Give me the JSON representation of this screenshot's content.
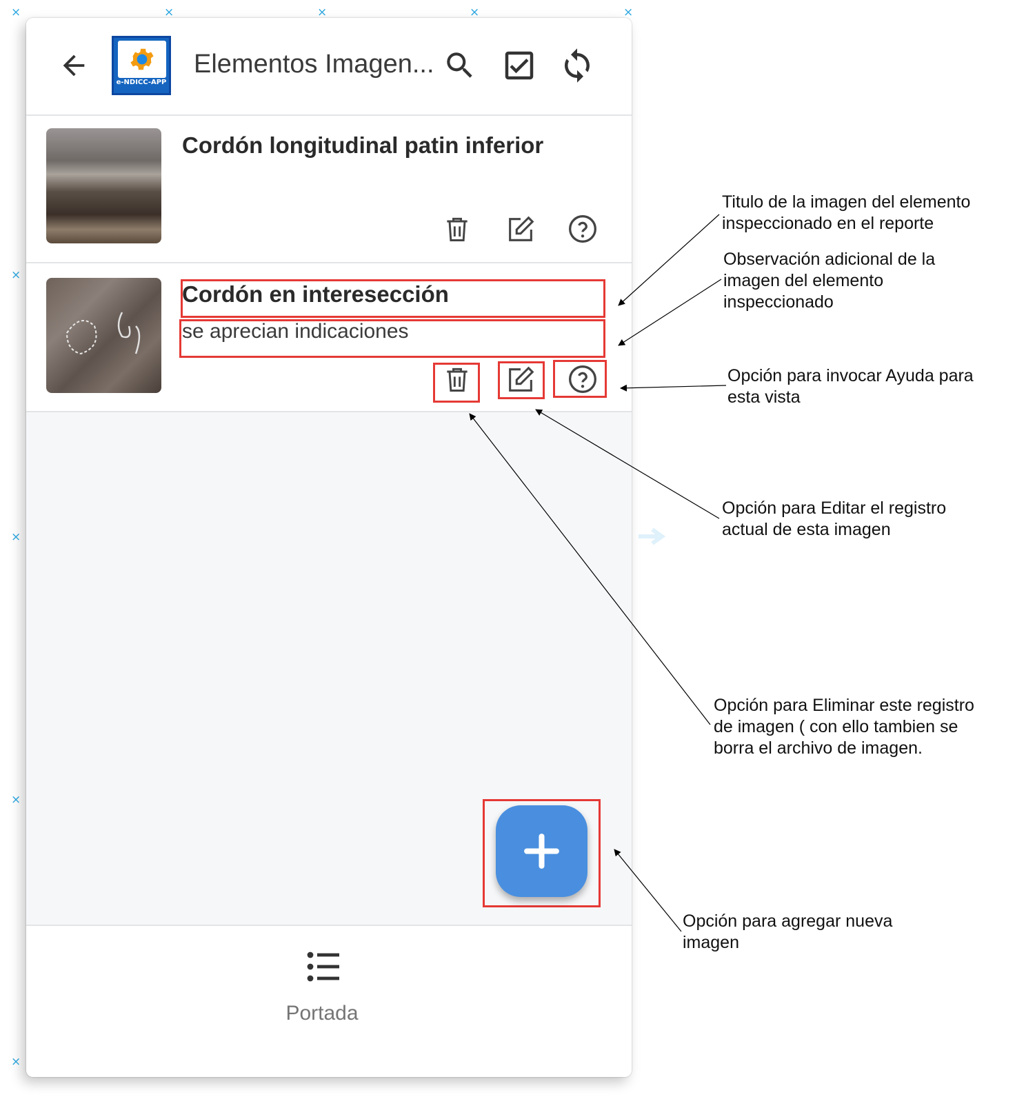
{
  "appbar": {
    "back_icon": "arrow-left-icon",
    "logo_text": "e-NDICC-APP",
    "title": "Elementos Imagen...",
    "search_icon": "search-icon",
    "check_icon": "checkbox-icon",
    "sync_icon": "sync-icon"
  },
  "items": [
    {
      "title": "Cordón longitudinal patin inferior",
      "observation": "",
      "icons": [
        "trash-icon",
        "edit-icon",
        "help-icon"
      ]
    },
    {
      "title": "Cordón en interesección",
      "observation": "se aprecian indicaciones",
      "icons": [
        "trash-icon",
        "edit-icon",
        "help-icon"
      ]
    }
  ],
  "fab": {
    "icon": "plus-icon"
  },
  "bottom_nav": {
    "label": "Portada",
    "icon": "list-icon"
  },
  "annotations": {
    "title": "Titulo de la imagen del elemento\ninspeccionado en el reporte",
    "observation": "Observación adicional de la\nimagen del elemento\ninspeccionado",
    "help": "Opción para invocar Ayuda para\nesta vista",
    "edit": "Opción para Editar el registro\nactual de esta imagen",
    "delete": "Opción para Eliminar este registro\nde imagen ( con ello tambien se\nborra el archivo de imagen.",
    "add": "Opción para agregar nueva\nimagen"
  },
  "colors": {
    "accent": "#4a8fdf",
    "highlight": "#e53935",
    "marker": "#2aa6e0"
  }
}
